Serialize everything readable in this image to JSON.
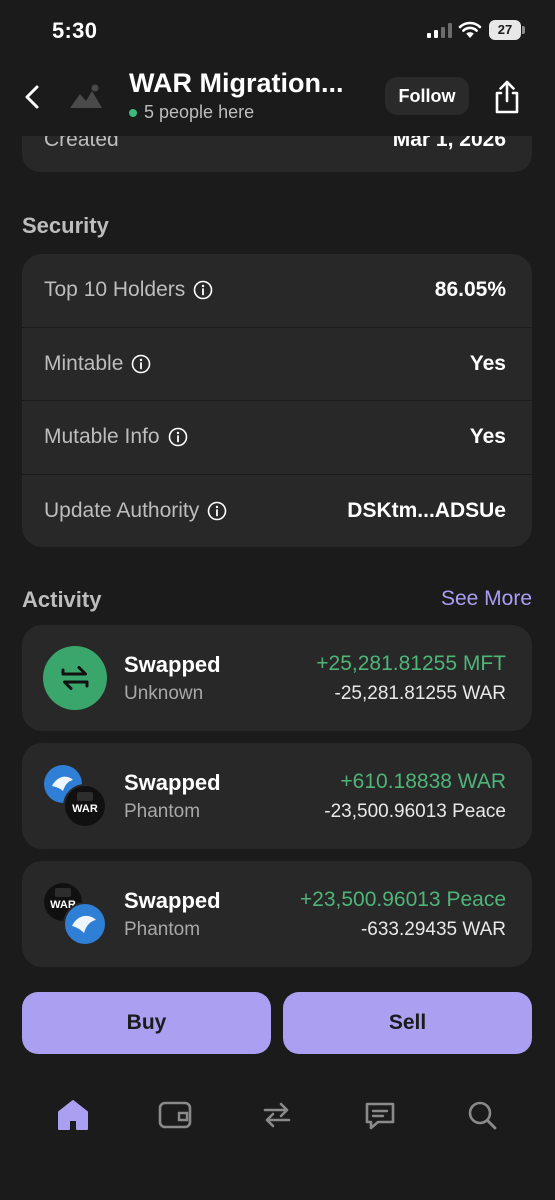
{
  "status_bar": {
    "time": "5:30",
    "battery": "27"
  },
  "header": {
    "title": "WAR Migration...",
    "subtitle": "5 people here",
    "follow_label": "Follow"
  },
  "created": {
    "label": "Created",
    "value": "Mar 1, 2026"
  },
  "security": {
    "title": "Security",
    "rows": [
      {
        "label": "Top 10 Holders",
        "value": "86.05%"
      },
      {
        "label": "Mintable",
        "value": "Yes"
      },
      {
        "label": "Mutable Info",
        "value": "Yes"
      },
      {
        "label": "Update Authority",
        "value": "DSKtm...ADSUe"
      }
    ]
  },
  "activity": {
    "title": "Activity",
    "see_more_label": "See More",
    "items": [
      {
        "title": "Swapped",
        "source": "Unknown",
        "amount_in": "+25,281.81255 MFT",
        "amount_out": "-25,281.81255 WAR"
      },
      {
        "title": "Swapped",
        "source": "Phantom",
        "amount_in": "+610.18838 WAR",
        "amount_out": "-23,500.96013 Peace",
        "avatar_text": "WAR"
      },
      {
        "title": "Swapped",
        "source": "Phantom",
        "amount_in": "+23,500.96013 Peace",
        "amount_out": "-633.29435 WAR",
        "avatar_text": "WAR"
      }
    ]
  },
  "actions": {
    "buy_label": "Buy",
    "sell_label": "Sell"
  },
  "colors": {
    "accent": "#ab9ff2",
    "positive": "#4fb478",
    "background": "#1b1b1b",
    "card": "#282828"
  },
  "tabs": [
    {
      "name": "home",
      "icon": "home-icon",
      "active": true
    },
    {
      "name": "wallet",
      "icon": "wallet-icon",
      "active": false
    },
    {
      "name": "swap",
      "icon": "swap-icon",
      "active": false
    },
    {
      "name": "chat",
      "icon": "chat-icon",
      "active": false
    },
    {
      "name": "search",
      "icon": "search-icon",
      "active": false
    }
  ]
}
